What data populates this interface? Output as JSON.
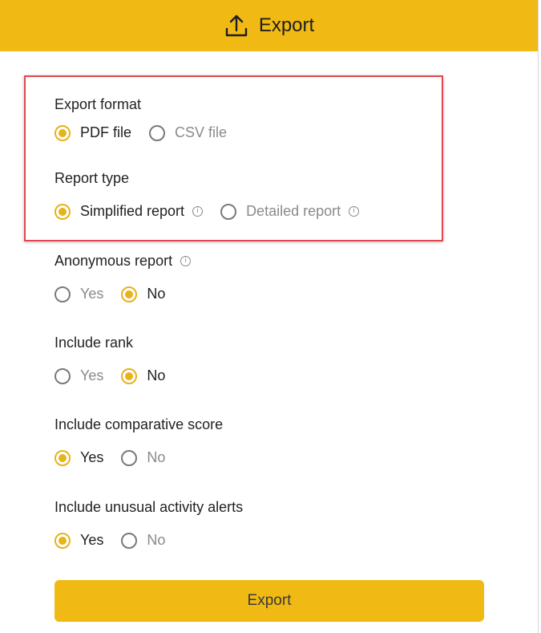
{
  "header": {
    "title": "Export",
    "icon": "upload-icon",
    "color": "#f0b913"
  },
  "export_format": {
    "label": "Export format",
    "options": [
      {
        "label": "PDF file",
        "selected": true
      },
      {
        "label": "CSV file",
        "selected": false
      }
    ]
  },
  "report_type": {
    "label": "Report type",
    "options": [
      {
        "label": "Simplified report",
        "selected": true,
        "info": "info-icon"
      },
      {
        "label": "Detailed report",
        "selected": false,
        "info": "info-icon"
      }
    ]
  },
  "anonymous_report": {
    "label": "Anonymous report",
    "info": "info-icon",
    "options": [
      {
        "label": "Yes",
        "selected": false
      },
      {
        "label": "No",
        "selected": true
      }
    ]
  },
  "include_rank": {
    "label": "Include rank",
    "options": [
      {
        "label": "Yes",
        "selected": false
      },
      {
        "label": "No",
        "selected": true
      }
    ]
  },
  "include_comparative_score": {
    "label": "Include comparative score",
    "options": [
      {
        "label": "Yes",
        "selected": true
      },
      {
        "label": "No",
        "selected": false
      }
    ]
  },
  "include_unusual_activity_alerts": {
    "label": "Include unusual activity alerts",
    "options": [
      {
        "label": "Yes",
        "selected": true
      },
      {
        "label": "No",
        "selected": false
      }
    ]
  },
  "export_button": {
    "label": "Export"
  },
  "colors": {
    "accent": "#f0b913",
    "radio_selected": "#e8b21a",
    "highlight_border": "#e2474f"
  }
}
